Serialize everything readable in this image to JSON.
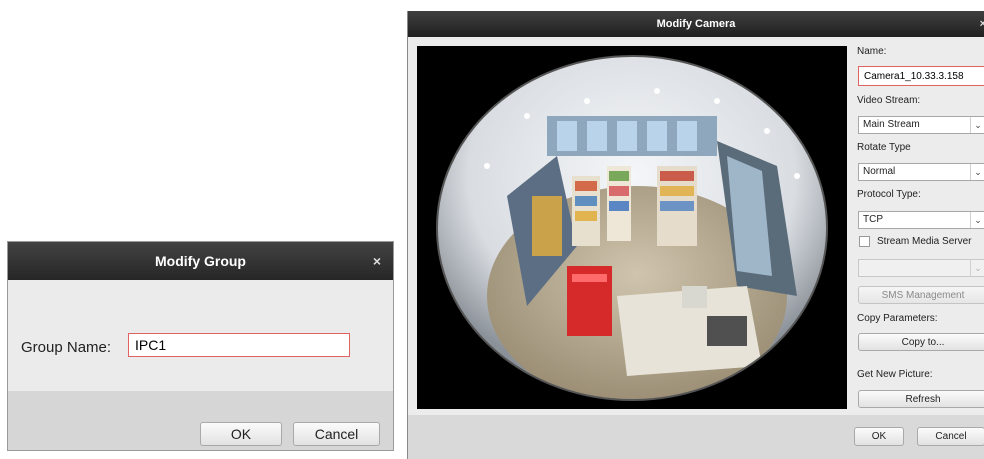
{
  "group_dialog": {
    "title": "Modify Group",
    "close_icon": "×",
    "group_name_label": "Group Name:",
    "group_name_value": "IPC1",
    "ok_label": "OK",
    "cancel_label": "Cancel"
  },
  "camera_dialog": {
    "title": "Modify Camera",
    "close_icon": "×",
    "name_label": "Name:",
    "name_value": "Camera1_10.33.3.158",
    "video_stream_label": "Video Stream:",
    "video_stream_value": "Main Stream",
    "rotate_type_label": "Rotate Type",
    "rotate_type_value": "Normal",
    "protocol_type_label": "Protocol Type:",
    "protocol_type_value": "TCP",
    "stream_media_server_label": "Stream Media Server",
    "stream_media_server_checked": false,
    "stream_media_server_select_value": "",
    "sms_management_label": "SMS Management",
    "copy_parameters_label": "Copy Parameters:",
    "copy_to_label": "Copy to...",
    "get_new_picture_label": "Get New Picture:",
    "refresh_label": "Refresh",
    "ok_label": "OK",
    "cancel_label": "Cancel",
    "dropdown_icon": "chevron-down-icon"
  }
}
